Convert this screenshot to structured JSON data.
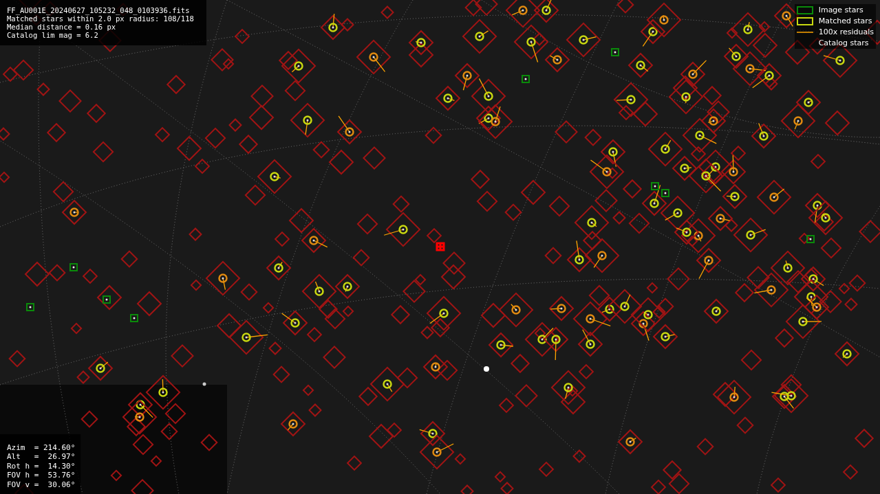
{
  "file_info": {
    "lines": [
      "FF_AU001E_20240627_105232_048_0103936.fits",
      "Matched stars within 2.0 px radius: 108/118",
      "Median distance = 0.16 px",
      "Catalog lim mag = 6.2"
    ]
  },
  "legend": [
    {
      "kind": "image",
      "label": "Image stars"
    },
    {
      "kind": "matched",
      "label": "Matched stars"
    },
    {
      "kind": "residual",
      "label": "100x residuals"
    },
    {
      "kind": "catalog",
      "label": "Catalog stars"
    }
  ],
  "pointing_info": {
    "lines": [
      "Azim  = 214.60°",
      "Alt   =  26.97°",
      "Rot h =  14.30°",
      "FOV h =  53.76°",
      "FOV v =  30.06°"
    ]
  }
}
